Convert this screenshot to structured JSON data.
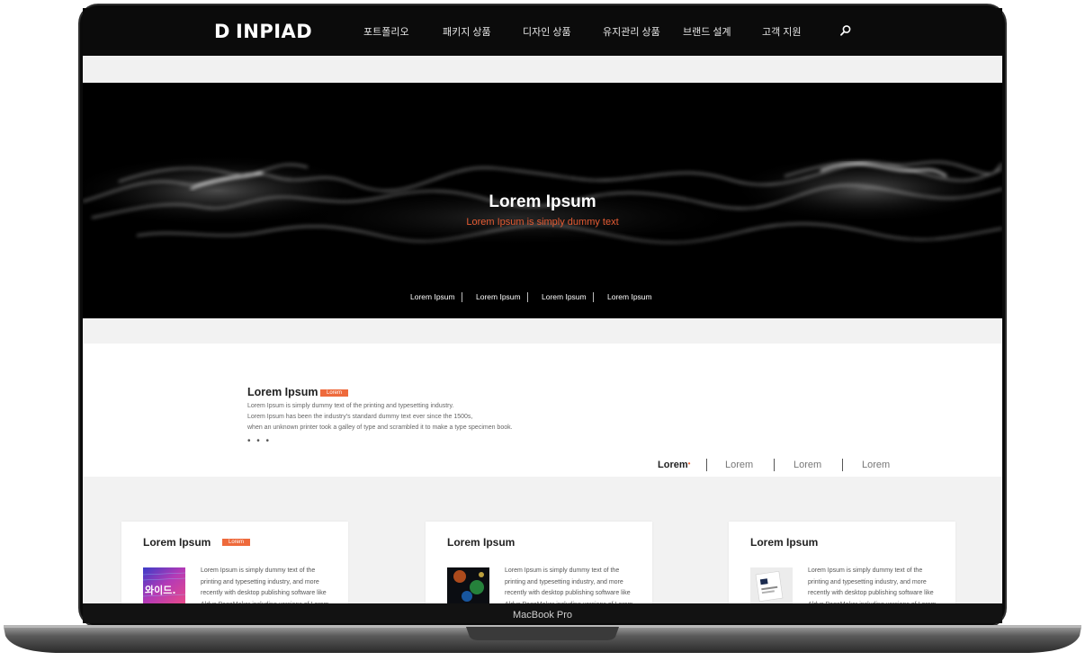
{
  "brand": {
    "logo_text": "INPIAD",
    "logo_mark": "D"
  },
  "nav": [
    {
      "label": "포트폴리오"
    },
    {
      "label": "패키지 상품"
    },
    {
      "label": "디자인 상품"
    },
    {
      "label": "유지관리 상품"
    },
    {
      "label": "브랜드 설계"
    },
    {
      "label": "고객 지원"
    }
  ],
  "hero": {
    "title": "Lorem Ipsum",
    "subtitle": "Lorem Ipsum is simply dummy text",
    "links": [
      {
        "label": "Lorem Ipsum"
      },
      {
        "label": "Lorem Ipsum"
      },
      {
        "label": "Lorem Ipsum"
      },
      {
        "label": "Lorem Ipsum"
      }
    ]
  },
  "intro": {
    "title": "Lorem Ipsum",
    "badge": "Lorem",
    "lines": [
      "Lorem Ipsum is simply dummy text of the printing and typesetting industry.",
      "Lorem Ipsum has been the industry's standard dummy text ever since the 1500s,",
      "when an unknown printer took a galley of type and scrambled it to make a type specimen book."
    ],
    "dots": "• • •"
  },
  "tabs": [
    {
      "label": "Lorem",
      "active": true
    },
    {
      "label": "Lorem",
      "active": false
    },
    {
      "label": "Lorem",
      "active": false
    },
    {
      "label": "Lorem",
      "active": false
    }
  ],
  "cards": [
    {
      "title": "Lorem Ipsum",
      "badge": "Lorem",
      "thumb_text": "와이드.",
      "text": "Lorem Ipsum is simply dummy text of the printing and typesetting industry, and more recently with desktop publishing software like Aldus PageMaker including versions of Lorem"
    },
    {
      "title": "Lorem Ipsum",
      "badge": "",
      "thumb_text": "",
      "text": "Lorem Ipsum is simply dummy text of the printing and typesetting industry, and more recently with desktop publishing software like Aldus PageMaker including versions of Lorem"
    },
    {
      "title": "Lorem Ipsum",
      "badge": "",
      "thumb_text": "",
      "text": "Lorem Ipsum is simply dummy text of the printing and typesetting industry, and more recently with desktop publishing software like Aldus PageMaker including versions of Lorem"
    }
  ],
  "device_label": "MacBook Pro",
  "icons": {
    "search": "search-icon",
    "logo": "logo-mark-icon"
  },
  "colors": {
    "accent": "#ee6a3c",
    "hero_sub": "#e55b33",
    "topbar": "#0b0b0b"
  }
}
